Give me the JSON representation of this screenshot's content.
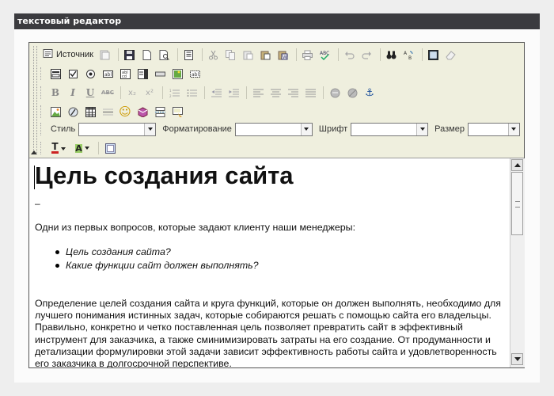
{
  "window": {
    "title": "текстовый редактор"
  },
  "toolbar": {
    "source_label": "Источник",
    "style_label": "Стиль",
    "format_label": "Форматирование",
    "font_label": "Шрифт",
    "size_label": "Размер",
    "style_value": "",
    "format_value": "",
    "font_value": "",
    "size_value": "",
    "bold": "B",
    "italic": "I",
    "underline": "U",
    "strike": "ABC",
    "subscript": "x₂",
    "superscript": "x²",
    "text_color_glyph": "T",
    "bg_color_glyph": "A",
    "anchor_glyph": "⚓",
    "smiley_glyph": "☺"
  },
  "document": {
    "heading": "Цель создания сайта",
    "dash": "–",
    "intro": "Одни из первых вопросов, которые задают клиенту наши менеджеры:",
    "bullets": [
      "Цель создания сайта?",
      "Какие функции сайт должен выполнять?"
    ],
    "body": "Определение целей создания сайта и круга функций, которые он должен выполнять, необходимо для лучшего понимания истинных задач, которые собираются решать с помощью сайта его владельцы. Правильно, конкретно и четко поставленная цель позволяет превратить сайт в эффективный инструмент для заказчика, а также сминимизировать затраты на его создание. От продуманности и детализации формулировки этой задачи зависит эффективность работы сайта и удовлетворенность его заказчика в долгосрочной перспективе."
  }
}
